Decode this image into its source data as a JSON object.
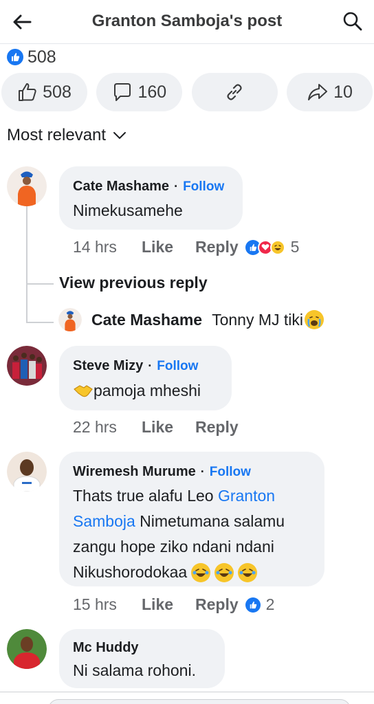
{
  "header": {
    "title": "Granton Samboja's post"
  },
  "post_summary": {
    "reaction_count": "508"
  },
  "actions": {
    "like_count": "508",
    "comment_count": "160",
    "share_count": "10"
  },
  "sort": {
    "label": "Most relevant"
  },
  "comments": [
    {
      "author": "Cate Mashame",
      "follow": "Follow",
      "text": "Nimekusamehe",
      "time": "14 hrs",
      "like": "Like",
      "reply": "Reply",
      "reaction_count": "5",
      "view_previous": "View previous reply",
      "reply_preview": {
        "author": "Cate Mashame",
        "text": "Tonny MJ tiki"
      }
    },
    {
      "author": "Steve Mizy",
      "follow": "Follow",
      "text": "pamoja mheshi",
      "time": "22 hrs",
      "like": "Like",
      "reply": "Reply"
    },
    {
      "author": "Wiremesh Murume",
      "follow": "Follow",
      "text_line1_prefix": "Thats true alafu Leo ",
      "mention_part1": "Granton",
      "mention_part2": "Samboja",
      "text_line2_suffix": " Nimetumana salamu",
      "text_line3": "zangu hope ziko ndani ndani",
      "text_line4": "Nikushorodokaa",
      "time": "15 hrs",
      "like": "Like",
      "reply": "Reply",
      "reaction_count": "2"
    },
    {
      "author": "Mc Huddy",
      "text": "Ni salama rohoni."
    }
  ],
  "colors": {
    "accent": "#1877f2",
    "bubble": "#f0f2f5",
    "meta": "#65676b"
  }
}
